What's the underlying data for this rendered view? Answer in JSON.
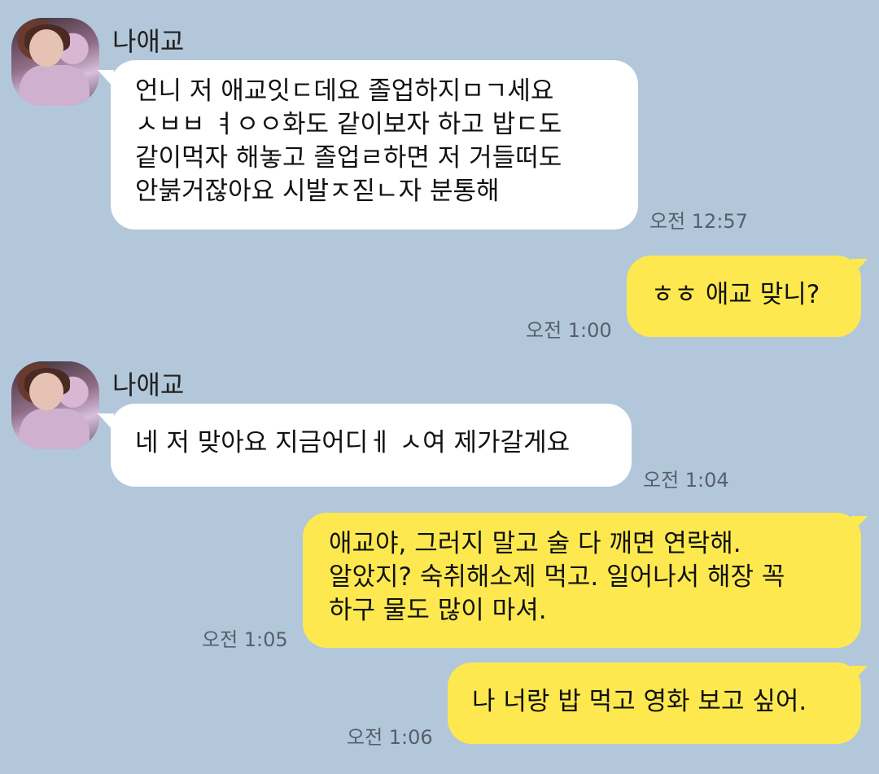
{
  "colors": {
    "background": "#b3c7da",
    "incoming_bubble": "#ffffff",
    "outgoing_bubble": "#fde94f"
  },
  "messages": [
    {
      "sender": "나애교",
      "text": "언니 저 애교잇ㄷ데요 졸업하지ㅁㄱ세요\nㅅㅂㅂ ㅕㅇㅇ화도 같이보자 하고 밥ㄷ도\n같이먹자 해놓고 졸업ㄹ하면 저 거들떠도\n안붉거잖아요 시발ㅈ짇ㄴ자 분통해",
      "time": "오전 12:57"
    },
    {
      "text": "ㅎㅎ 애교 맞니?",
      "time": "오전 1:00"
    },
    {
      "sender": "나애교",
      "text": "네 저 맞아요 지금어디ㅔ ㅅ여 제가갈게요",
      "time": "오전 1:04"
    },
    {
      "text": "애교야, 그러지 말고 술 다 깨면 연락해.\n알았지? 숙취해소제 먹고. 일어나서 해장 꼭\n하구 물도 많이 마셔.",
      "time": "오전 1:05"
    },
    {
      "text": "나 너랑 밥 먹고 영화 보고 싶어.",
      "time": "오전 1:06"
    }
  ]
}
